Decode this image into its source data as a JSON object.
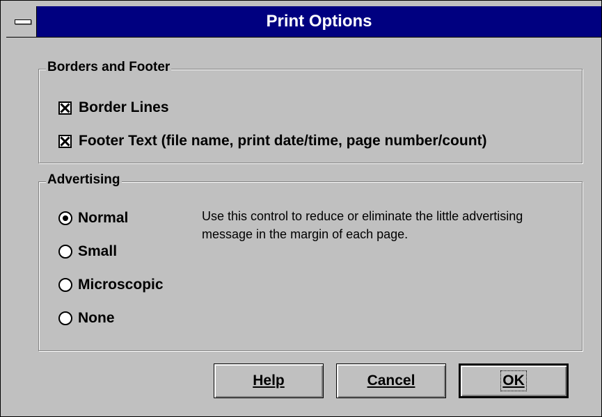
{
  "window": {
    "title": "Print Options"
  },
  "borders_footer": {
    "group_label": "Borders and Footer",
    "options": [
      {
        "label": "Border Lines",
        "checked": true
      },
      {
        "label": "Footer Text (file name, print date/time, page number/count)",
        "checked": true
      }
    ]
  },
  "advertising": {
    "group_label": "Advertising",
    "options": [
      {
        "label": "Normal",
        "selected": true
      },
      {
        "label": "Small",
        "selected": false
      },
      {
        "label": "Microscopic",
        "selected": false
      },
      {
        "label": "None",
        "selected": false
      }
    ],
    "description": "Use this control to reduce or eliminate the little advertising message in the margin of each page."
  },
  "buttons": {
    "help": "Help",
    "cancel": "Cancel",
    "ok": "OK"
  }
}
